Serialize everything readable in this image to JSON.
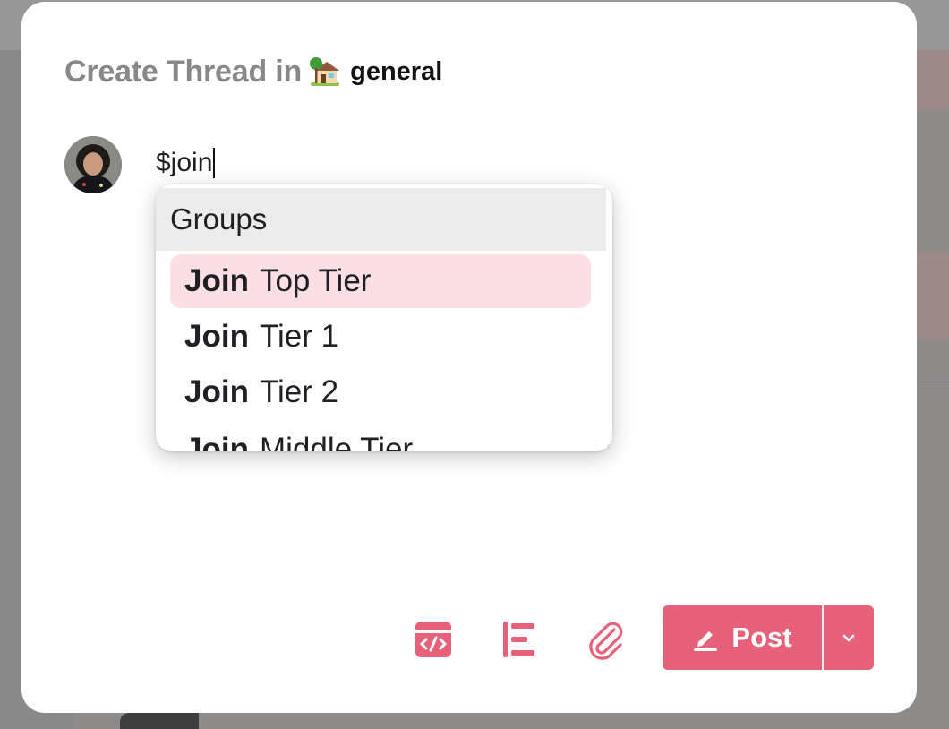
{
  "modal": {
    "title_prefix": "Create Thread in",
    "channel_emoji": "cabin-with-tree-icon",
    "channel_name": "general"
  },
  "editor": {
    "text": "$join"
  },
  "mention_dropdown": {
    "group_header": "Groups",
    "items": [
      {
        "bold": "Join",
        "name": "Top Tier",
        "selected": true
      },
      {
        "bold": "Join",
        "name": "Tier 1",
        "selected": false
      },
      {
        "bold": "Join",
        "name": "Tier 2",
        "selected": false
      },
      {
        "bold": "Join",
        "name": "Middle Tier",
        "selected": false
      }
    ]
  },
  "toolbar": {
    "embed_icon": "code-embed-icon",
    "format_icon": "text-align-icon",
    "attach_icon": "paperclip-icon",
    "post_label": "Post",
    "post_icon": "pencil-icon",
    "menu_icon": "chevron-down-icon"
  },
  "colors": {
    "accent": "#e8617a",
    "selected_bg": "#fbdfe4",
    "header_bg": "#ececec",
    "title_gray": "#888888"
  }
}
